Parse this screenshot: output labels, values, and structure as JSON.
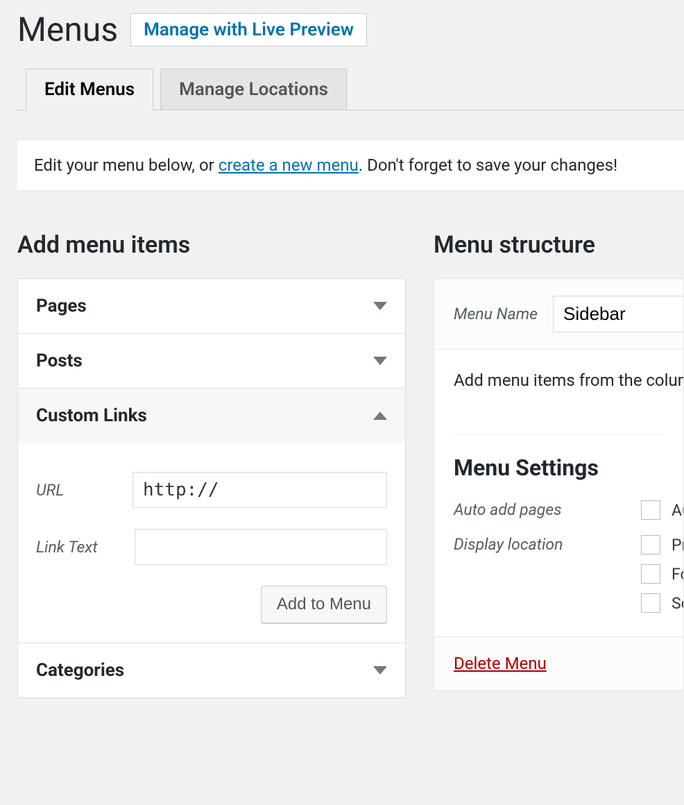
{
  "header": {
    "title": "Menus",
    "action_button": "Manage with Live Preview"
  },
  "tabs": {
    "edit": "Edit Menus",
    "manage": "Manage Locations"
  },
  "notice": {
    "prefix": "Edit your menu below, or ",
    "link": "create a new menu",
    "suffix": ". Don't forget to save your changes!"
  },
  "left": {
    "heading": "Add menu items",
    "sections": {
      "pages": "Pages",
      "posts": "Posts",
      "custom_links": "Custom Links",
      "categories": "Categories"
    },
    "custom_links": {
      "url_label": "URL",
      "url_value": "http://",
      "link_text_label": "Link Text",
      "link_text_value": "",
      "add_button": "Add to Menu"
    }
  },
  "right": {
    "heading": "Menu structure",
    "menu_name_label": "Menu Name",
    "menu_name_value": "Sidebar",
    "body_hint": "Add menu items from the column on the left.",
    "settings_heading": "Menu Settings",
    "auto_add_label": "Auto add pages",
    "auto_add_options": [
      "Automatically add new top-level pages to this menu"
    ],
    "display_location_label": "Display location",
    "display_location_options": [
      "Primary Menu",
      "Footer Menu",
      "Social Links Menu"
    ],
    "delete_link": "Delete Menu"
  }
}
